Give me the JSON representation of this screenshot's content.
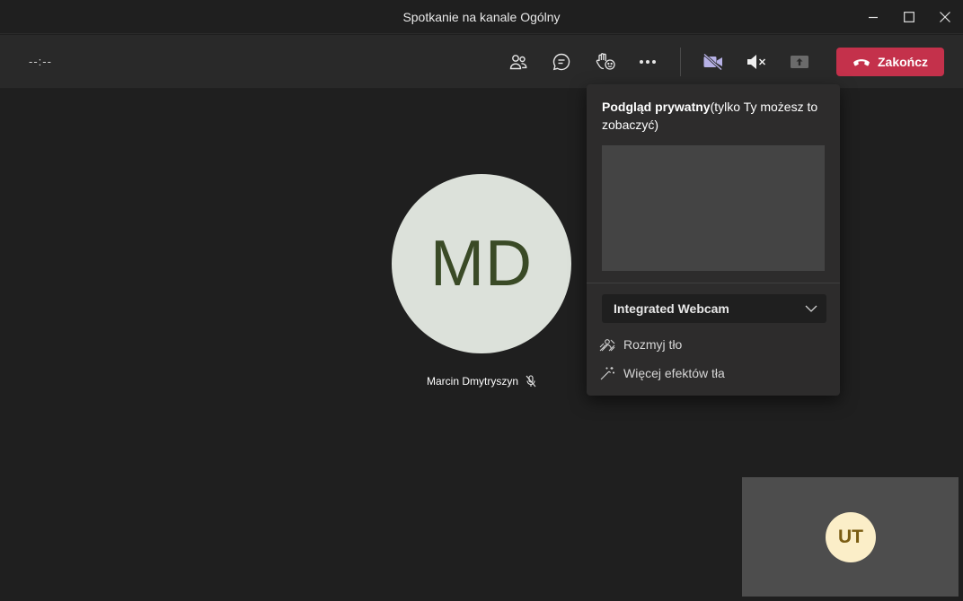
{
  "window": {
    "title": "Spotkanie na kanale Ogólny"
  },
  "toolbar": {
    "timer": "--:--",
    "end_label": "Zakończ",
    "buttons": {
      "participants": "people-icon",
      "chat": "chat-icon",
      "reactions": "raise-hand-icon",
      "more": "more-icon",
      "camera": "camera-off-icon",
      "mic": "mic-muted-icon",
      "share": "share-icon"
    }
  },
  "stage": {
    "participant": {
      "initials": "MD",
      "name": "Marcin Dmytryszyn"
    },
    "self": {
      "initials": "UT"
    }
  },
  "popup": {
    "title_bold": "Podgląd prywatny",
    "title_rest": "(tylko Ty możesz to zobaczyć)",
    "camera": {
      "selected": "Integrated Webcam"
    },
    "effects": [
      {
        "label": "Rozmyj tło",
        "icon": "blur-icon"
      },
      {
        "label": "Więcej efektów tła",
        "icon": "magic-wand-icon"
      }
    ]
  },
  "colors": {
    "end_button": "#c4314b",
    "accent_camera": "#b6b1e6",
    "avatar_md_bg": "#dce1da",
    "avatar_md_text": "#3a4a26",
    "avatar_ut_bg": "#fbeec8",
    "avatar_ut_text": "#7a5c12"
  }
}
